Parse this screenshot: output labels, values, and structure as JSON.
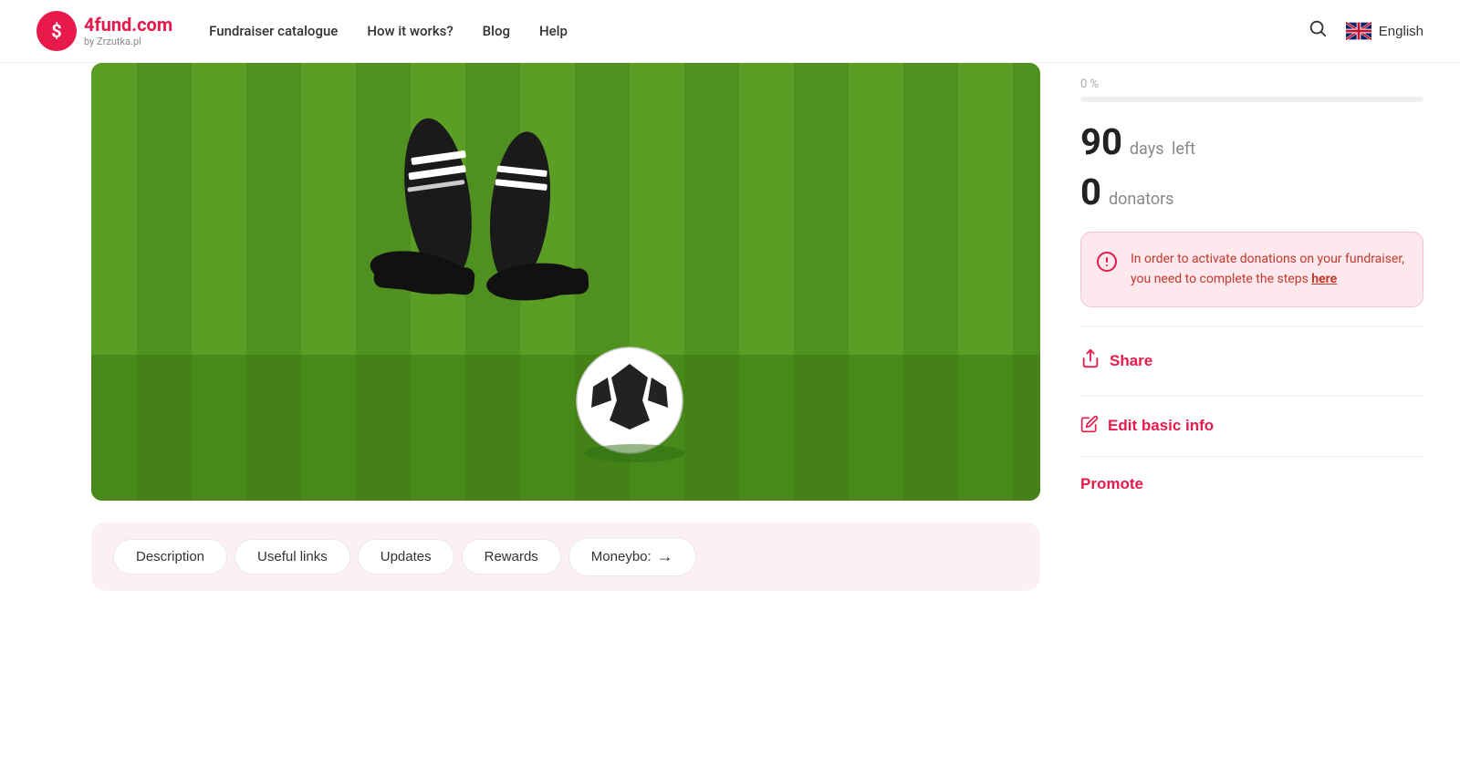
{
  "header": {
    "logo_main": "4fund.com",
    "logo_sub": "by Zrzutka.pl",
    "logo_icon": "$",
    "nav": [
      {
        "id": "fundraiser-catalogue",
        "label": "Fundraiser catalogue"
      },
      {
        "id": "how-it-works",
        "label": "How it works?"
      },
      {
        "id": "blog",
        "label": "Blog"
      },
      {
        "id": "help",
        "label": "Help"
      }
    ],
    "language": "English"
  },
  "sidebar": {
    "progress_percent": "0 %",
    "days_value": "90",
    "days_label": "days",
    "days_suffix": "left",
    "donators_value": "0",
    "donators_label": "donators",
    "alert_text": "In order to activate donations on your fundraiser, you need to complete the steps",
    "alert_link_text": "here",
    "share_label": "Share",
    "edit_basic_info_label": "Edit basic info",
    "promote_label": "Promote"
  },
  "tabs": [
    {
      "id": "description",
      "label": "Description"
    },
    {
      "id": "useful-links",
      "label": "Useful links"
    },
    {
      "id": "updates",
      "label": "Updates"
    },
    {
      "id": "rewards",
      "label": "Rewards"
    },
    {
      "id": "moneybox",
      "label": "Moneybo:"
    }
  ]
}
